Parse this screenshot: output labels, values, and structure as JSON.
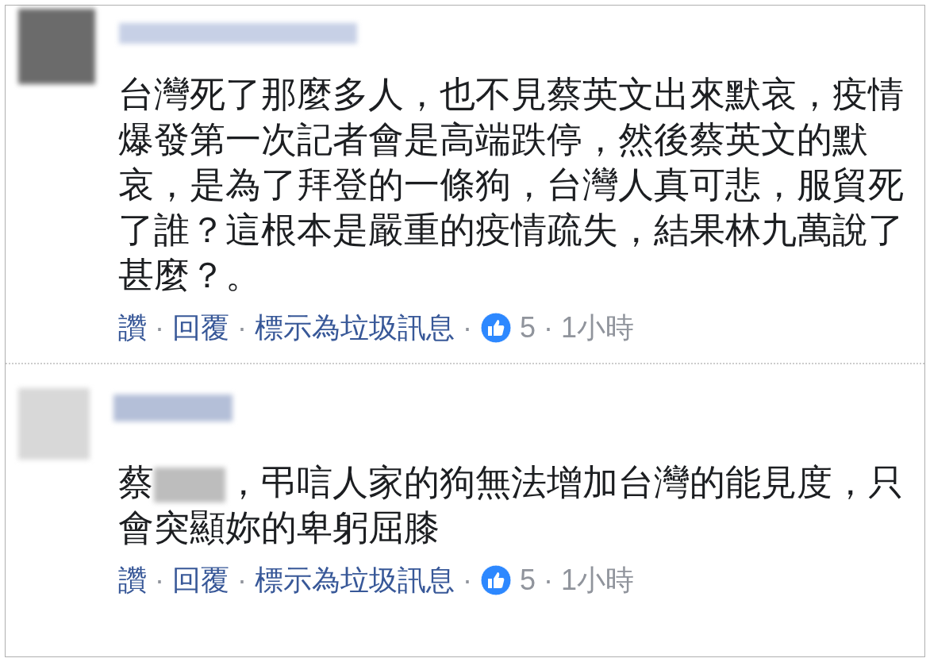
{
  "comments": [
    {
      "parts": [
        {
          "kind": "text",
          "text": "台灣死了那麼多人，也不見蔡英文出來默哀，疫情爆發第一次記者會是高端跌停，然後蔡英文的默哀，是為了拜登的一條狗，台灣人真可悲，服貿死了誰？這根本是嚴重的疫情疏失，結果林九萬說了甚麼？。"
        }
      ],
      "actions": [
        "讚",
        "回覆",
        "標示為垃圾訊息"
      ],
      "separator": "·",
      "like_count": "5",
      "time": "1小時"
    },
    {
      "parts": [
        {
          "kind": "text",
          "text": "蔡"
        },
        {
          "kind": "redacted"
        },
        {
          "kind": "text",
          "text": "，弔唁人家的狗無法增加台灣的能見度，只會突顯妳的卑躬屈膝"
        }
      ],
      "actions": [
        "讚",
        "回覆",
        "標示為垃圾訊息"
      ],
      "separator": "·",
      "like_count": "5",
      "time": "1小時"
    }
  ]
}
